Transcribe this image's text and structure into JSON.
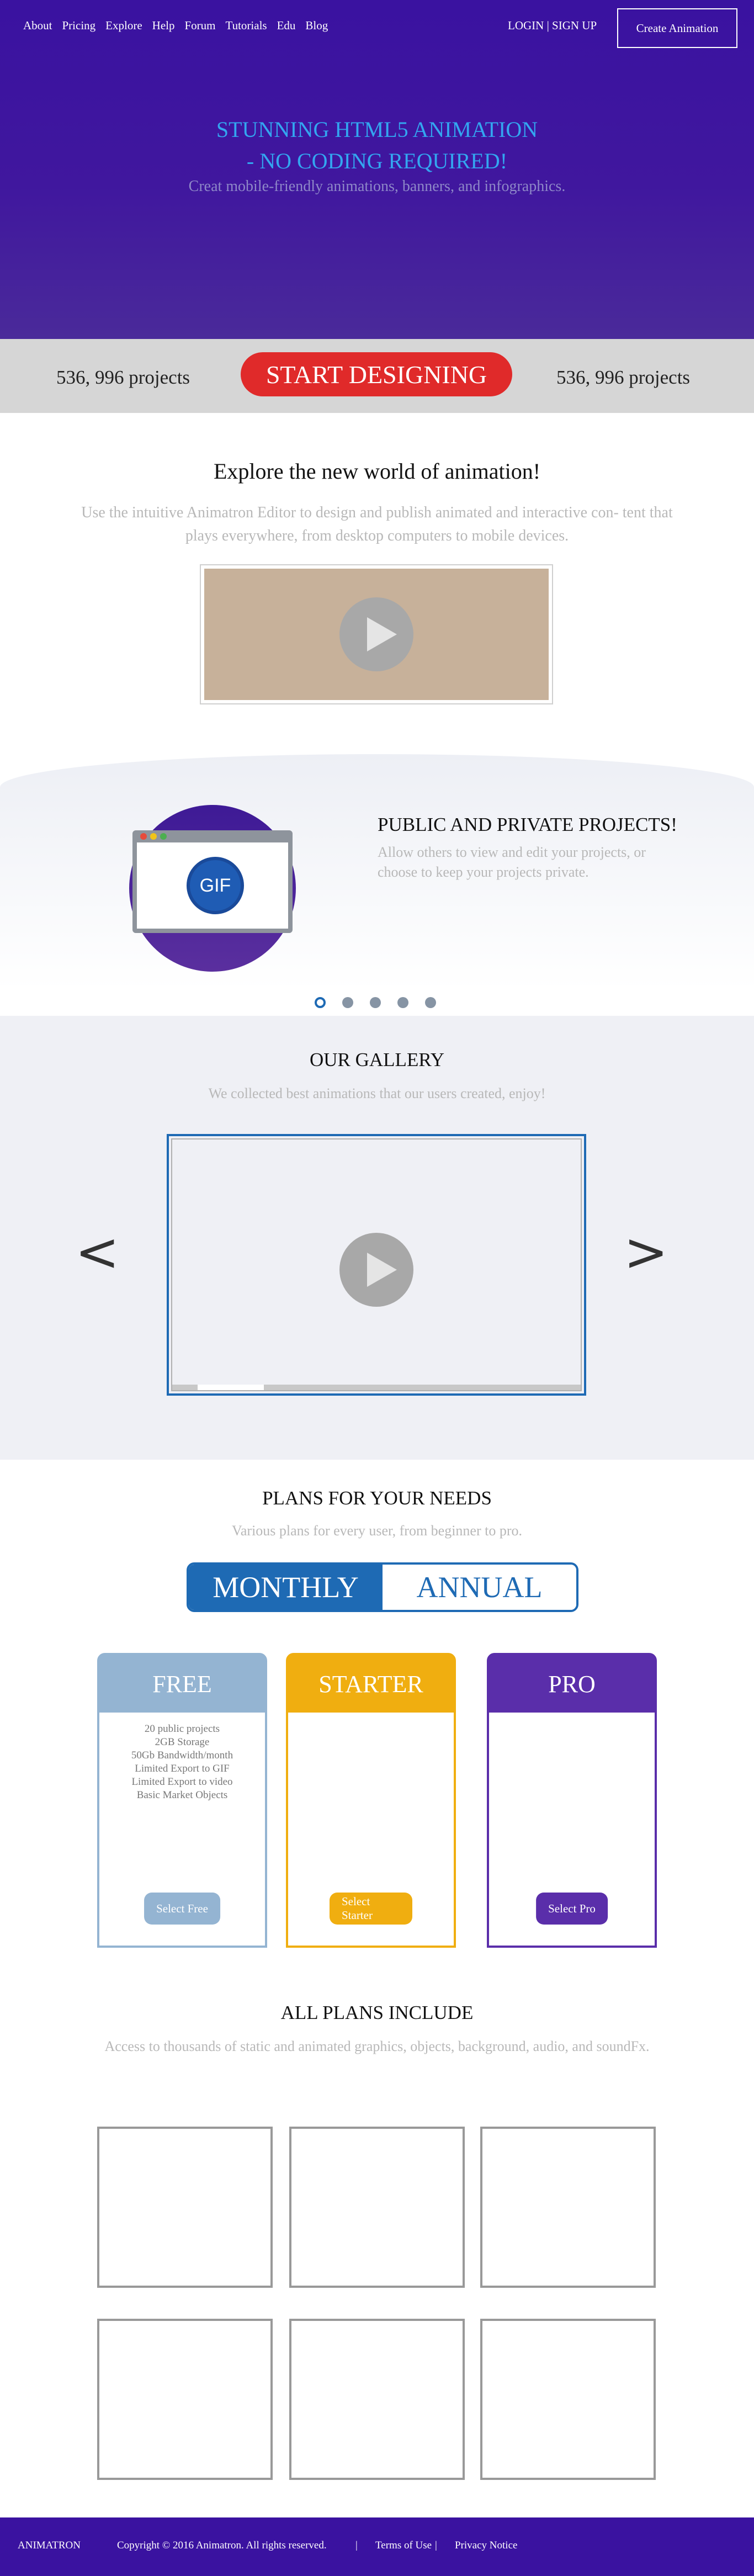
{
  "header": {
    "nav": [
      "About",
      "Pricing",
      "Explore",
      "Help",
      "Forum",
      "Tutorials",
      "Edu",
      "Blog"
    ],
    "login_label": "LOGIN | SIGN UP",
    "create_label": "Create Animation"
  },
  "hero": {
    "title": "STUNNING HTML5 ANIMATION - NO CODING REQUIRED!",
    "subtitle": "Creat mobile-friendly animations, banners, and infographics."
  },
  "band": {
    "left_count": "536, 996 projects",
    "start_label": "START DESIGNING",
    "right_count": "536, 996 projects"
  },
  "explore": {
    "title": "Explore the new world of animation!",
    "text": "Use the intuitive Animatron Editor to design and publish animated and interactive con- tent that plays everywhere, from desktop computers to mobile devices."
  },
  "feature": {
    "badge": "GIF",
    "title": "PUBLIC AND PRIVATE PROJECTS!",
    "text": "Allow others to view and edit your projects, or choose to keep your projects private.",
    "slide_count": 5,
    "active_slide": 0
  },
  "gallery": {
    "title": "OUR GALLERY",
    "subtitle": "We collected best animations that our users created, enjoy!",
    "prev": "<",
    "next": ">"
  },
  "plans": {
    "title": "PLANS FOR YOUR NEEDS",
    "subtitle": "Various plans for every user, from beginner to pro.",
    "toggle": {
      "monthly": "MONTHLY",
      "annual": "ANNUAL",
      "selected": "monthly"
    },
    "items": [
      {
        "name": "FREE",
        "features": [
          "20 public projects",
          "2GB Storage",
          "50Gb Bandwidth/month",
          "Limited Export to GIF",
          "Limited Export to video",
          "Basic Market Objects"
        ],
        "button": "Select Free",
        "color": "#94b4d2"
      },
      {
        "name": "STARTER",
        "features": [],
        "button": "Select Starter",
        "color": "#f0ae10"
      },
      {
        "name": "PRO",
        "features": [],
        "button": "Select Pro",
        "color": "#5a2eaa"
      }
    ]
  },
  "include": {
    "title": "ALL PLANS INCLUDE",
    "subtitle": "Access to thousands of static and animated graphics, objects, background, audio, and soundFx."
  },
  "footer": {
    "brand": "ANIMATRON",
    "copyright": "Copyright © 2016 Animatron. All rights reserved.",
    "sep1": "|",
    "terms": "Terms of Use",
    "sep2": "|",
    "privacy": "Privacy Notice"
  },
  "colors": {
    "brand_purple": "#3a12a0",
    "accent_blue": "#1e6ab4",
    "cta_red": "#e02a2a"
  }
}
